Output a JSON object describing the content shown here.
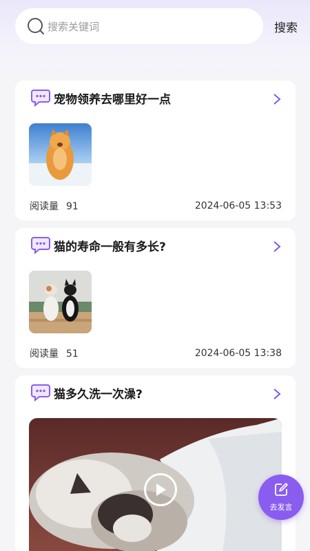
{
  "search": {
    "placeholder": "搜索关键词",
    "button_label": "搜索"
  },
  "posts": [
    {
      "title": "宠物领养去哪里好一点",
      "views_label": "阅读量",
      "views": "91",
      "timestamp": "2024-06-05 13:53",
      "media": "image-orange-cat-on-snow"
    },
    {
      "title": "猫的寿命一般有多长?",
      "views_label": "阅读量",
      "views": "51",
      "timestamp": "2024-06-05 13:38",
      "media": "image-two-cats-sitting"
    },
    {
      "title": "猫多久洗一次澡?",
      "media": "video-ragdoll-cat-in-blanket"
    }
  ],
  "fab": {
    "label": "去发言"
  },
  "colors": {
    "accent": "#8a5cf0",
    "title": "#1a1a1a",
    "meta": "#333333"
  }
}
